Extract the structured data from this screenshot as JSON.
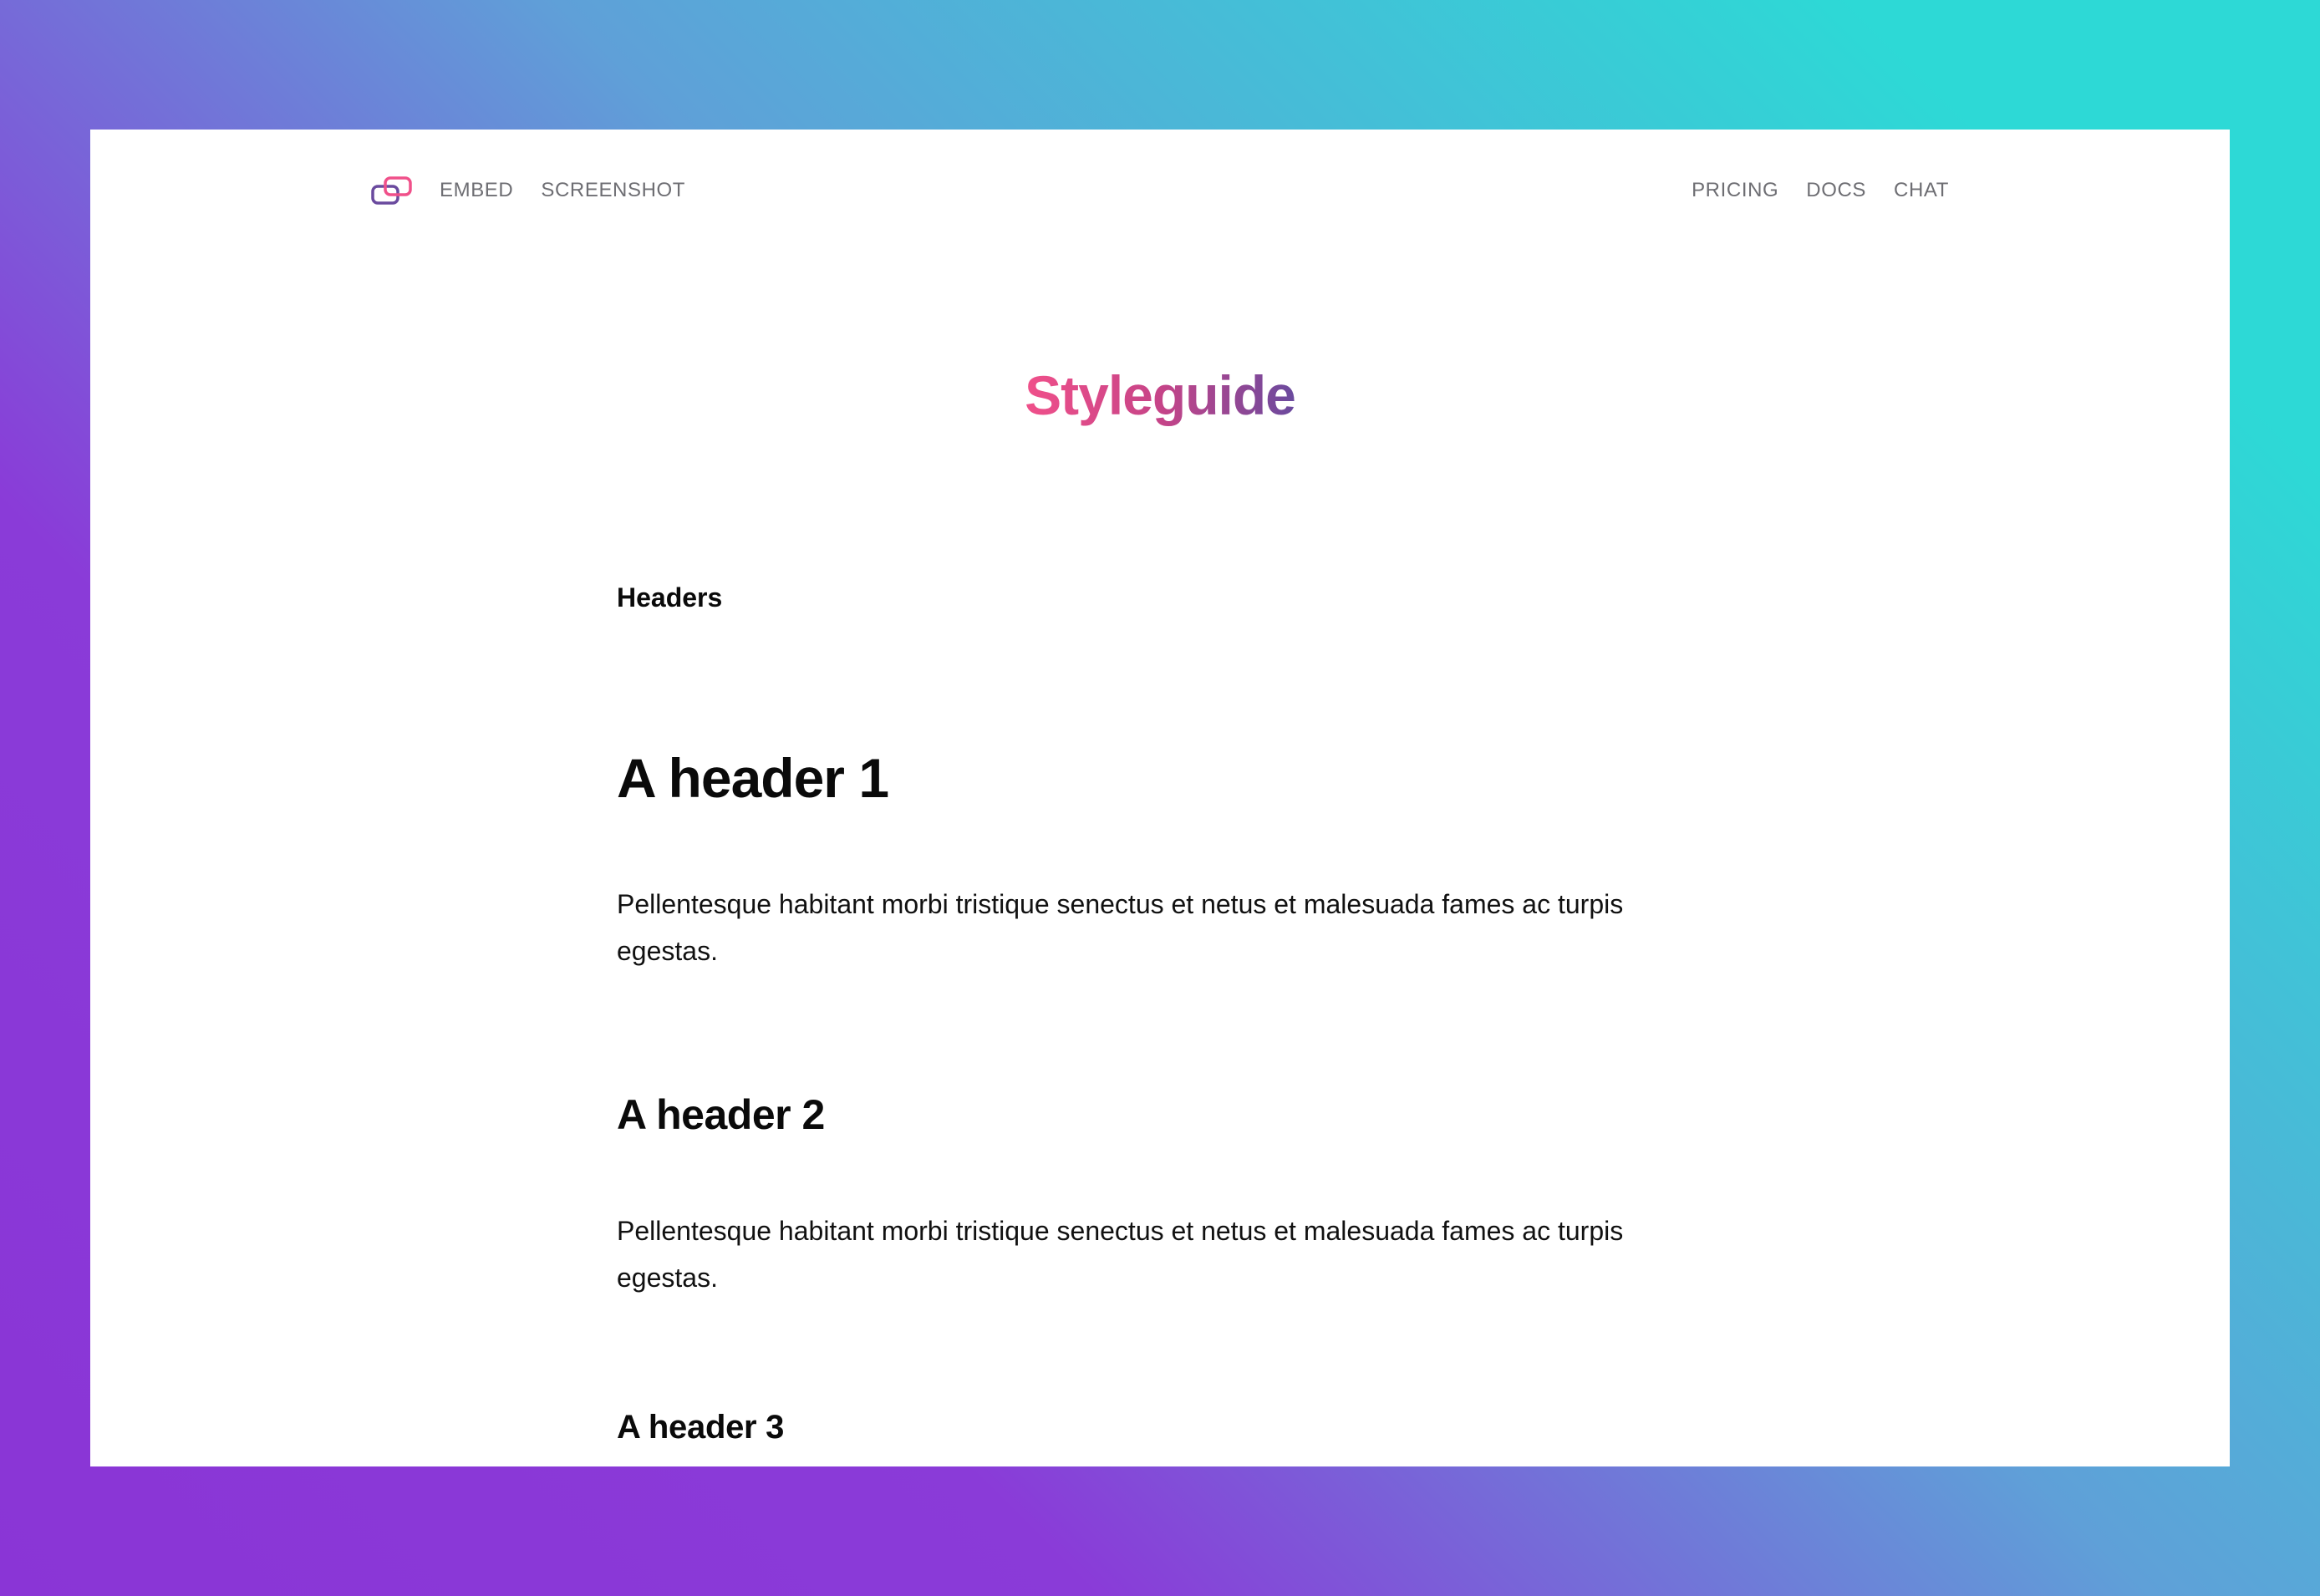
{
  "nav": {
    "logo_icon": "linked-windows-icon",
    "left_links": [
      "EMBED",
      "SCREENSHOT"
    ],
    "right_links": [
      "PRICING",
      "DOCS",
      "CHAT"
    ]
  },
  "page": {
    "title": "Styleguide",
    "section_label": "Headers",
    "h1": "A header 1",
    "paragraph_1": "Pellentesque habitant morbi tristique senectus et netus et malesuada fames ac turpis egestas.",
    "h2": "A header 2",
    "paragraph_2": "Pellentesque habitant morbi tristique senectus et netus et malesuada fames ac turpis egestas.",
    "h3": "A header 3"
  },
  "colors": {
    "title_gradient_start": "#f0508a",
    "title_gradient_end": "#6a4a9e",
    "nav_text": "#6e6e73",
    "background_gradient_teal": "#2dd9d6",
    "background_gradient_purple": "#8a35d6"
  }
}
